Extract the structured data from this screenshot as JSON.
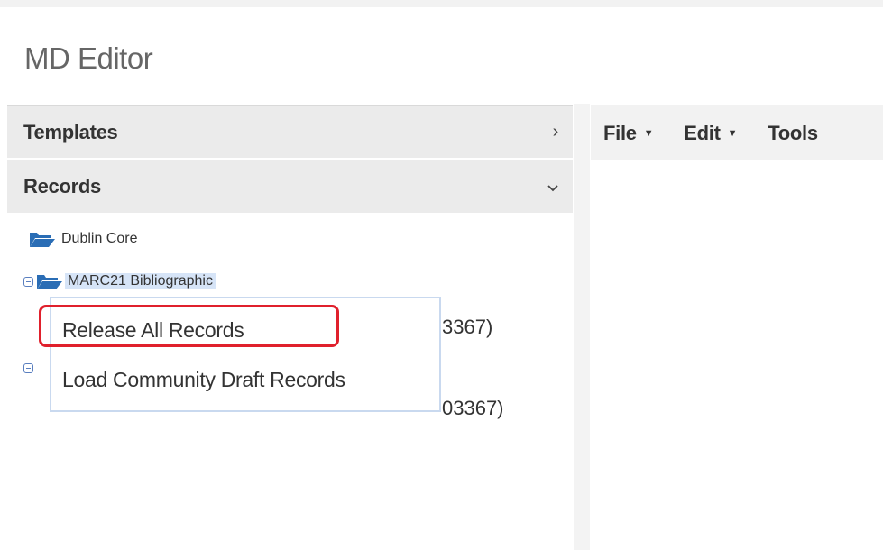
{
  "page": {
    "title": "MD Editor"
  },
  "sidebar": {
    "templates": {
      "label": "Templates",
      "chevron": "chevron-right-icon"
    },
    "records": {
      "label": "Records",
      "chevron": "chevron-down-icon"
    }
  },
  "toolbar": {
    "menus": [
      {
        "label": "File"
      },
      {
        "label": "Edit"
      },
      {
        "label": "Tools"
      }
    ]
  },
  "tree": {
    "dublin_core": "Dublin Core",
    "marc21": "MARC21 Bibliographic",
    "record1_suffix": "3367)",
    "record2_suffix": "03367)"
  },
  "context_menu": {
    "items": [
      {
        "label": "Release All Records"
      },
      {
        "label": "Load Community Draft Records"
      }
    ]
  },
  "colors": {
    "folder": "#2a6db5",
    "highlight": "#e0202c",
    "header_bg": "#ebebeb",
    "selection": "#d6e4f7"
  }
}
